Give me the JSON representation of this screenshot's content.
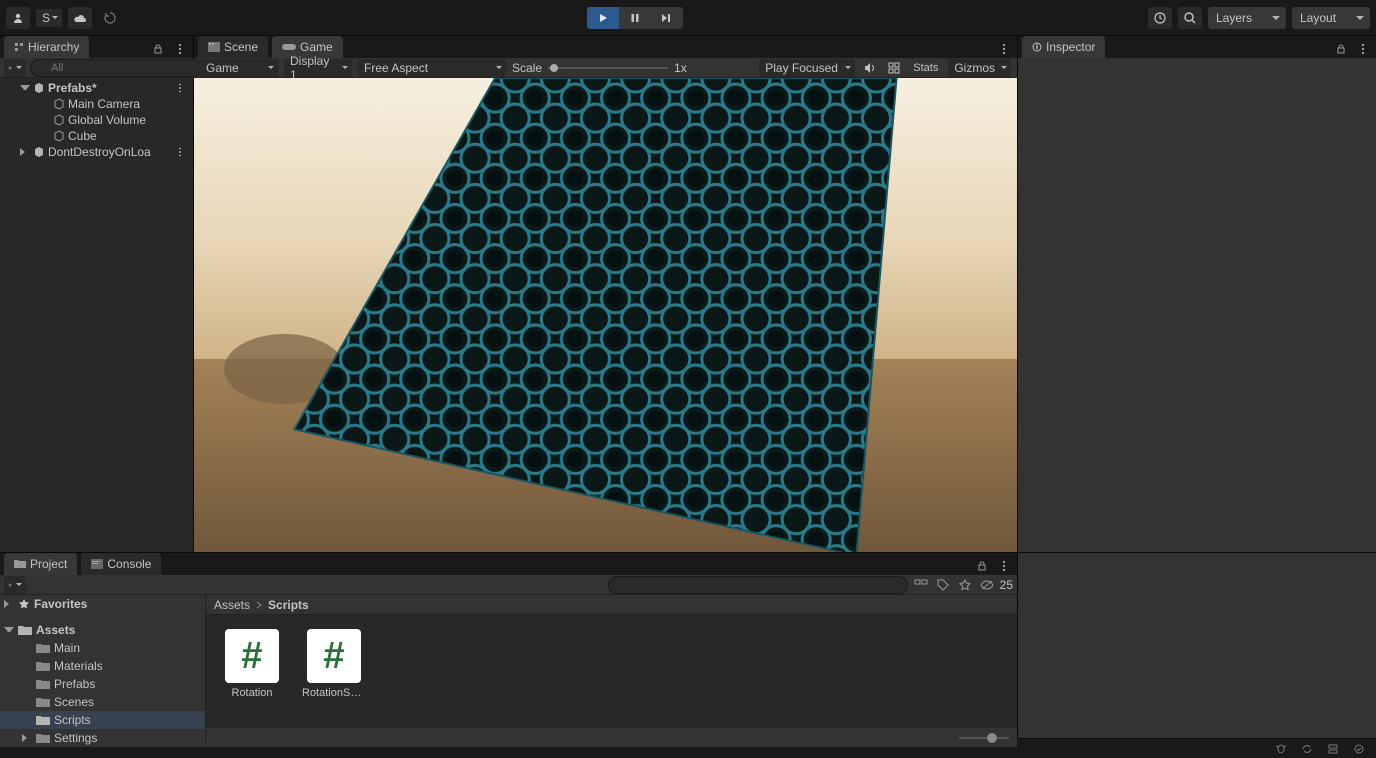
{
  "toolbar": {
    "account_letter": "S",
    "layers_label": "Layers",
    "layout_label": "Layout"
  },
  "hierarchy": {
    "tab_label": "Hierarchy",
    "search_placeholder": "All",
    "scene_name": "Prefabs*",
    "items": [
      "Main Camera",
      "Global Volume",
      "Cube"
    ],
    "persistent": "DontDestroyOnLoa"
  },
  "center": {
    "scene_tab": "Scene",
    "game_tab": "Game",
    "game_dropdown": "Game",
    "display_dropdown": "Display 1",
    "aspect_dropdown": "Free Aspect",
    "scale_label": "Scale",
    "scale_value": "1x",
    "play_focus": "Play Focused",
    "stats": "Stats",
    "gizmos": "Gizmos"
  },
  "inspector": {
    "tab_label": "Inspector"
  },
  "project": {
    "project_tab": "Project",
    "console_tab": "Console",
    "hidden_count": "25",
    "favorites": "Favorites",
    "root": "Assets",
    "folders": [
      "Main",
      "Materials",
      "Prefabs",
      "Scenes",
      "Scripts",
      "Settings"
    ],
    "breadcrumb": [
      "Assets",
      "Scripts"
    ],
    "assets": [
      {
        "name": "Rotation"
      },
      {
        "name": "RotationScr..."
      }
    ]
  }
}
